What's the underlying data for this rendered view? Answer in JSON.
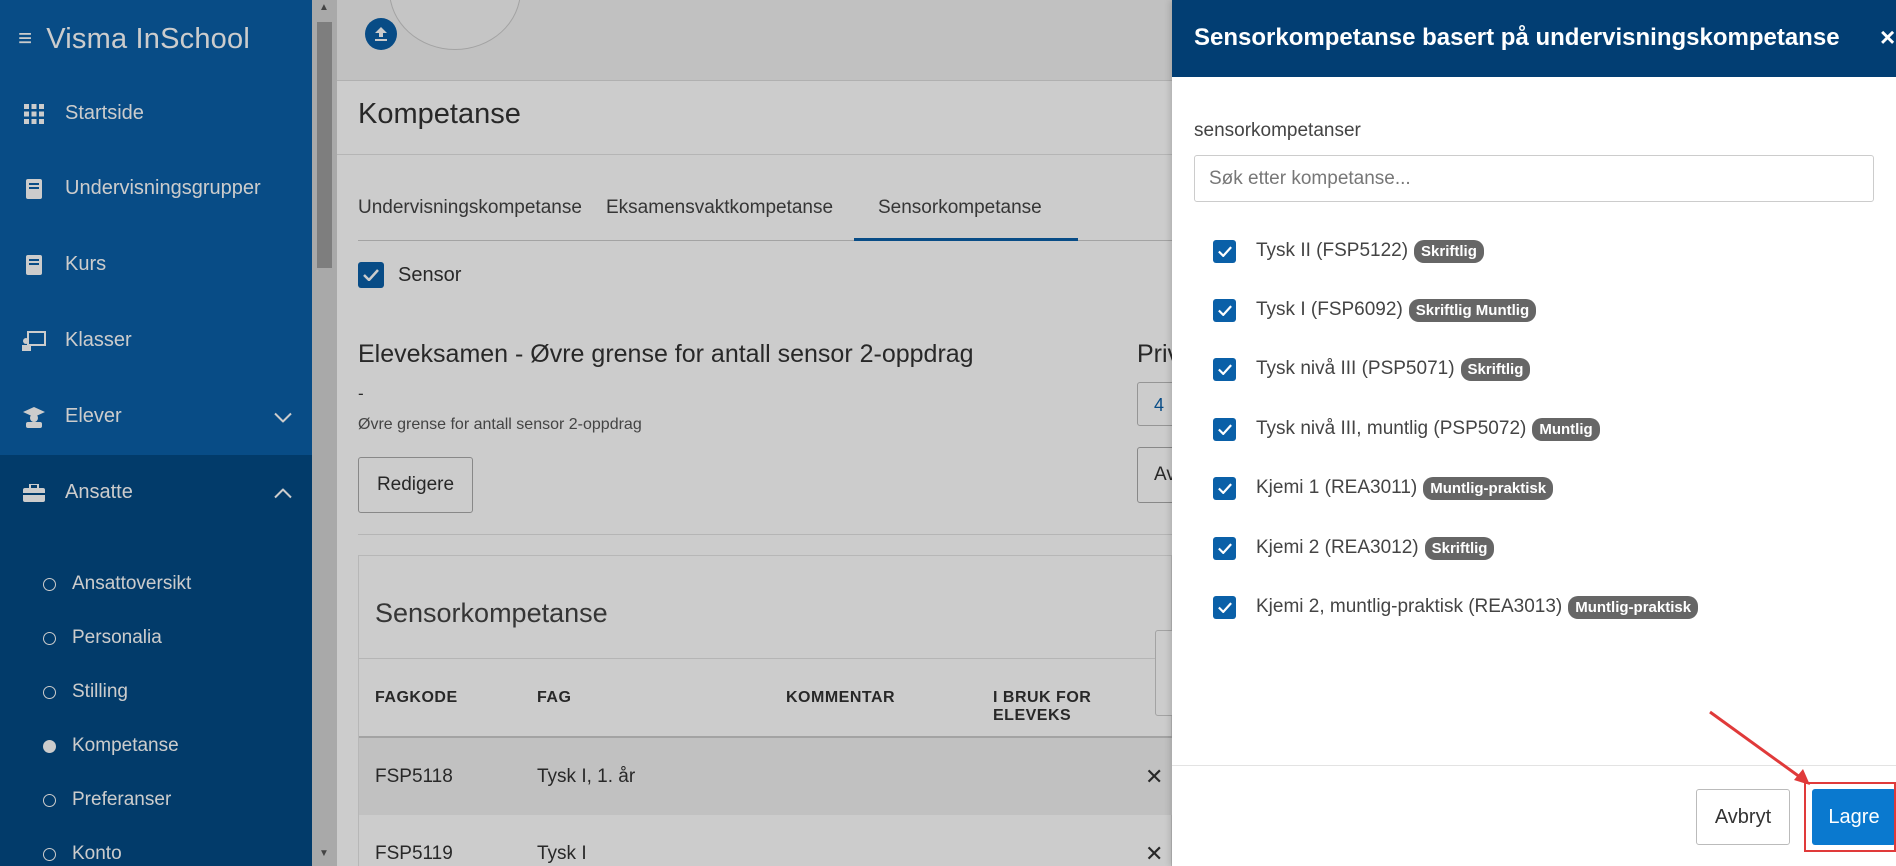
{
  "app": {
    "title": "Visma InSchool"
  },
  "sidebar": {
    "items": [
      {
        "label": "Startside",
        "icon": "grid-icon"
      },
      {
        "label": "Undervisningsgrupper",
        "icon": "book-icon"
      },
      {
        "label": "Kurs",
        "icon": "book-icon"
      },
      {
        "label": "Klasser",
        "icon": "classroom-icon"
      },
      {
        "label": "Elever",
        "icon": "student-icon"
      },
      {
        "label": "Ansatte",
        "icon": "briefcase-icon"
      }
    ],
    "sub_items": [
      {
        "label": "Ansattoversikt"
      },
      {
        "label": "Personalia"
      },
      {
        "label": "Stilling"
      },
      {
        "label": "Kompetanse",
        "active": true
      },
      {
        "label": "Preferanser"
      },
      {
        "label": "Konto"
      }
    ]
  },
  "main": {
    "page_title": "Kompetanse",
    "tabs": [
      {
        "label": "Undervisningskompetanse"
      },
      {
        "label": "Eksamensvaktkompetanse"
      },
      {
        "label": "Sensorkompetanse",
        "active": true
      }
    ],
    "sensor_label": "Sensor",
    "section_title": "Eleveksamen - Øvre grense for antall sensor 2-oppdrag",
    "section_value": "-",
    "section_hint": "Øvre grense for antall sensor 2-oppdrag",
    "edit_button": "Redigere",
    "priv_title": "Priv",
    "priv_value": "4",
    "priv_button": "Av",
    "card_title": "Sensorkompetanse",
    "table": {
      "headers": [
        "FAGKODE",
        "FAG",
        "KOMMENTAR",
        "I BRUK FOR ELEVEKS"
      ],
      "rows": [
        {
          "code": "FSP5118",
          "subject": "Tysk I, 1. år",
          "in_use": "✕"
        },
        {
          "code": "FSP5119",
          "subject": "Tysk I",
          "in_use": "✕"
        }
      ]
    }
  },
  "panel": {
    "title": "Sensorkompetanse basert på undervisningskompetanse",
    "close": "×",
    "field_label": "sensorkompetanser",
    "search_placeholder": "Søk etter kompetanse...",
    "competences": [
      {
        "name": "Tysk II (FSP5122)",
        "badge": "Skriftlig"
      },
      {
        "name": "Tysk I (FSP6092)",
        "badge": "Skriftlig Muntlig"
      },
      {
        "name": "Tysk nivå III (PSP5071)",
        "badge": "Skriftlig"
      },
      {
        "name": "Tysk nivå III, muntlig (PSP5072)",
        "badge": "Muntlig"
      },
      {
        "name": "Kjemi 1 (REA3011)",
        "badge": "Muntlig-praktisk"
      },
      {
        "name": "Kjemi 2 (REA3012)",
        "badge": "Skriftlig"
      },
      {
        "name": "Kjemi 2, muntlig-praktisk (REA3013)",
        "badge": "Muntlig-praktisk"
      }
    ],
    "cancel_button": "Avbryt",
    "save_button": "Lagre"
  },
  "colors": {
    "sidebar": "#0a60a8",
    "sidebar_active": "#034a85",
    "panel_header": "#023e73",
    "primary_button": "#0a79cf",
    "annotation": "#e03a3a"
  }
}
